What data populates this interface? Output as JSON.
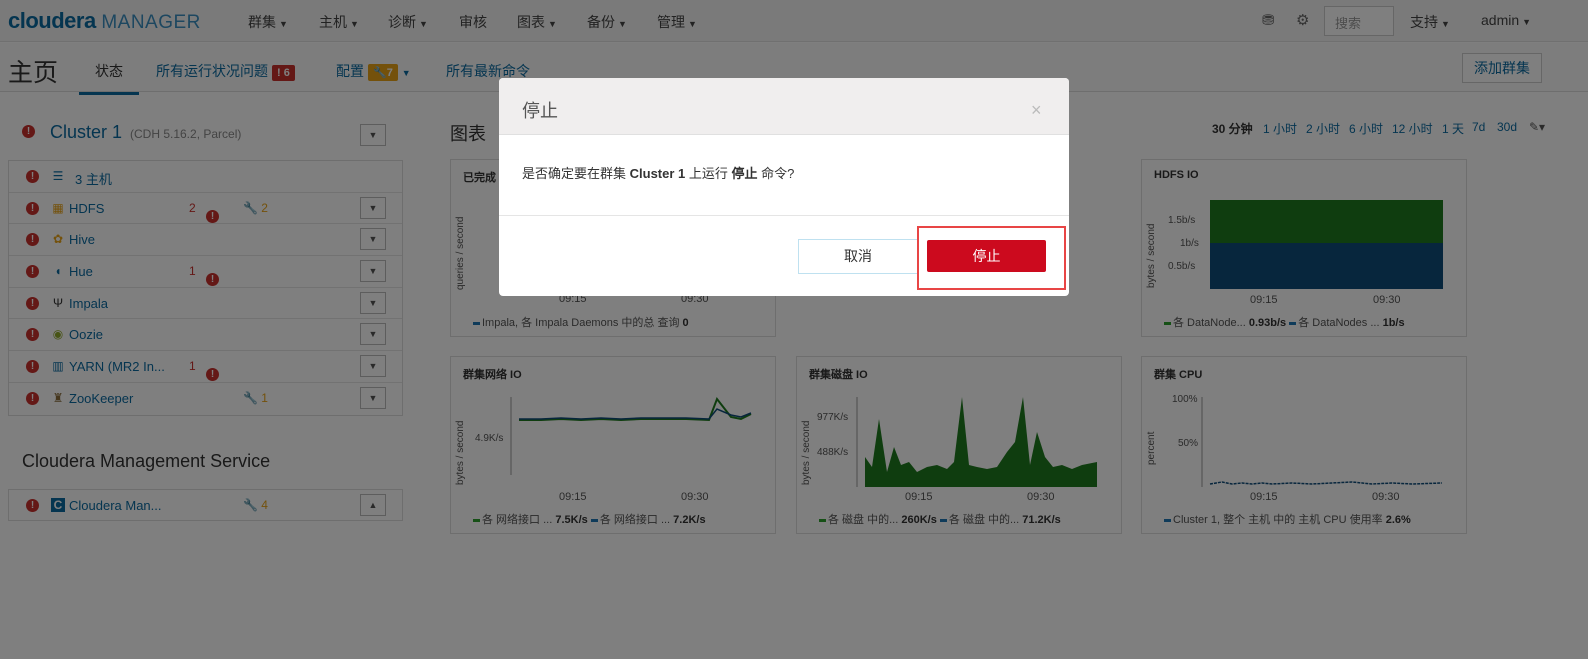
{
  "topnav": {
    "logo_main": "cloudera",
    "logo_sub": "MANAGER",
    "items": [
      "群集",
      "主机",
      "诊断",
      "审核",
      "图表",
      "备份",
      "管理"
    ],
    "search_placeholder": "搜索",
    "support": "支持",
    "user": "admin"
  },
  "subnav": {
    "page_title": "主页",
    "tab_status": "状态",
    "tab_health": "所有运行状况问题",
    "health_count": "6",
    "tab_config": "配置",
    "config_count": "7",
    "tab_commands": "所有最新命令",
    "add_cluster": "添加群集"
  },
  "cluster": {
    "name": "Cluster 1",
    "version": "(CDH 5.16.2, Parcel)",
    "services": [
      {
        "name": "3 主机",
        "err": "",
        "cfg": "",
        "icon": "list-icon",
        "glyph": "☰"
      },
      {
        "name": "HDFS",
        "err": "2",
        "cfg": "2",
        "icon": "hdfs-icon",
        "glyph": "▦"
      },
      {
        "name": "Hive",
        "err": "",
        "cfg": "",
        "icon": "hive-icon",
        "glyph": "✿"
      },
      {
        "name": "Hue",
        "err": "1",
        "cfg": "",
        "icon": "hue-icon",
        "glyph": "◖"
      },
      {
        "name": "Impala",
        "err": "",
        "cfg": "",
        "icon": "impala-icon",
        "glyph": "Ψ"
      },
      {
        "name": "Oozie",
        "err": "",
        "cfg": "",
        "icon": "oozie-icon",
        "glyph": "◉"
      },
      {
        "name": "YARN (MR2 In...",
        "err": "1",
        "cfg": "",
        "icon": "yarn-icon",
        "glyph": "▥"
      },
      {
        "name": "ZooKeeper",
        "err": "",
        "cfg": "1",
        "icon": "zookeeper-icon",
        "glyph": "♜"
      }
    ]
  },
  "mgmt": {
    "title": "Cloudera Management Service",
    "service": "Cloudera Man...",
    "cfg": "4"
  },
  "charts_section": {
    "title": "图表",
    "ranges": [
      "30 分钟",
      "1 小时",
      "2 小时",
      "6 小时",
      "12 小时",
      "1 天",
      "7d",
      "30d"
    ]
  },
  "chart_data": [
    {
      "type": "line",
      "title": "已完成",
      "ylabel": "queries / second",
      "x": [
        "09:15",
        "09:30"
      ],
      "series": [
        {
          "name": "Impala, 各 Impala Daemons 中的总 查询",
          "values": [
            0,
            0
          ],
          "last": "0",
          "color": "#1f77b4"
        }
      ]
    },
    {
      "type": "area",
      "title": "HDFS IO",
      "ylabel": "bytes / second",
      "yticks": [
        "1.5b/s",
        "1b/s",
        "0.5b/s"
      ],
      "x": [
        "09:15",
        "09:30"
      ],
      "series": [
        {
          "name": "各 DataNode...",
          "last": "0.93b/s",
          "color": "#2ca02c"
        },
        {
          "name": "各 DataNodes ...",
          "last": "1b/s",
          "color": "#1f77b4"
        }
      ]
    },
    {
      "type": "line",
      "title": "群集网络 IO",
      "ylabel": "bytes / second",
      "yticks": [
        "4.9K/s"
      ],
      "x": [
        "09:15",
        "09:30"
      ],
      "series": [
        {
          "name": "各 网络接口 ...",
          "last": "7.5K/s",
          "color": "#2ca02c"
        },
        {
          "name": "各 网络接口 ...",
          "last": "7.2K/s",
          "color": "#1f77b4"
        }
      ]
    },
    {
      "type": "area",
      "title": "群集磁盘 IO",
      "ylabel": "bytes / second",
      "yticks": [
        "977K/s",
        "488K/s"
      ],
      "x": [
        "09:15",
        "09:30"
      ],
      "series": [
        {
          "name": "各 磁盘 中的...",
          "last": "260K/s",
          "color": "#2ca02c"
        },
        {
          "name": "各 磁盘 中的...",
          "last": "71.2K/s",
          "color": "#1f77b4"
        }
      ]
    },
    {
      "type": "line",
      "title": "群集 CPU",
      "ylabel": "percent",
      "yticks": [
        "100%",
        "50%"
      ],
      "x": [
        "09:15",
        "09:30"
      ],
      "series": [
        {
          "name": "Cluster 1, 整个 主机 中的 主机 CPU 使用率",
          "last": "2.6%",
          "color": "#1f77b4"
        }
      ]
    }
  ],
  "modal": {
    "title": "停止",
    "close": "×",
    "body_prefix": "是否确定要在群集 ",
    "body_cluster": "Cluster 1",
    "body_mid": " 上运行 ",
    "body_cmd": "停止",
    "body_suffix": " 命令?",
    "cancel": "取消",
    "confirm": "停止"
  }
}
